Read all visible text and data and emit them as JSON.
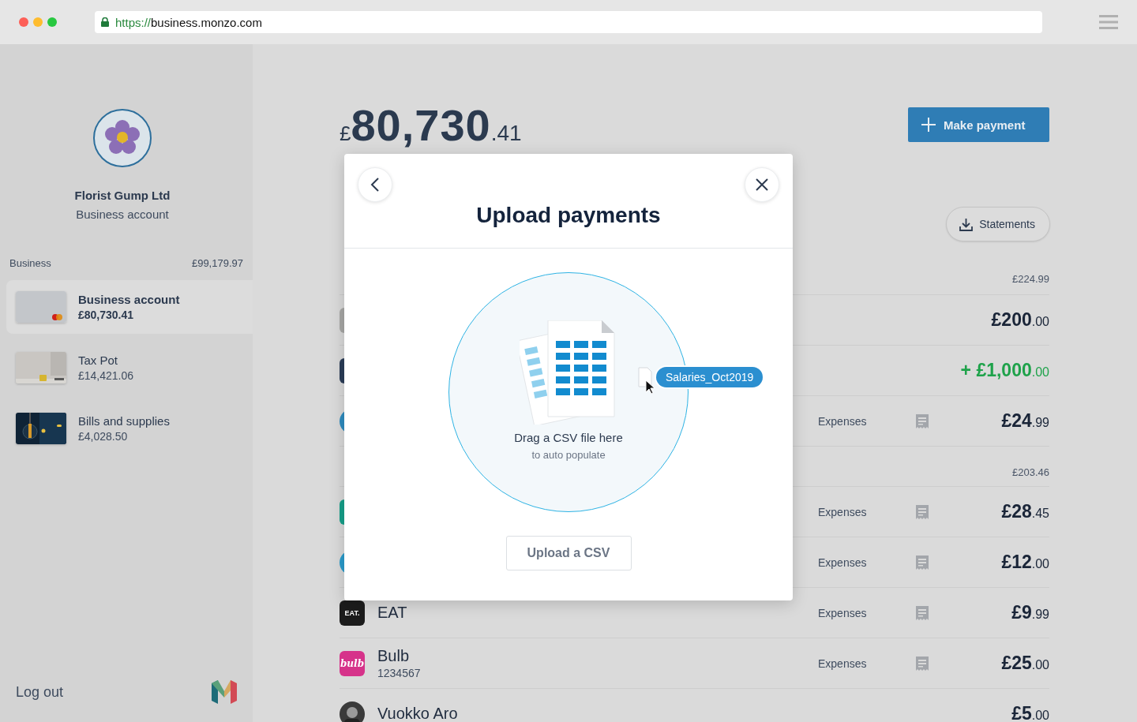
{
  "browser": {
    "url_scheme": "https://",
    "url_host": "business.monzo.com"
  },
  "sidebar": {
    "business_name": "Florist Gump Ltd",
    "account_type": "Business account",
    "group": {
      "label": "Business",
      "total": "£99,179.97"
    },
    "accounts": [
      {
        "name": "Business account",
        "balance": "£80,730.41",
        "selected": true,
        "kind": "card"
      },
      {
        "name": "Tax Pot",
        "balance": "£14,421.06",
        "selected": false,
        "kind": "picture"
      },
      {
        "name": "Bills and supplies",
        "balance": "£4,028.50",
        "selected": false,
        "kind": "picture"
      }
    ],
    "logout": "Log out"
  },
  "balance": {
    "currency": "£",
    "major": "80,730",
    "minor": ".41"
  },
  "make_payment": "Make payment",
  "statements": "Statements",
  "sections": [
    {
      "total": "£224.99",
      "transactions": [
        {
          "avatar": {
            "kind": "square",
            "color": "#a8a8a6"
          },
          "amount_major": "£200",
          "amount_minor": ".00",
          "incoming": false
        },
        {
          "avatar": {
            "kind": "square",
            "color": "#2b3d58"
          },
          "amount_major": "+ £1,000",
          "amount_minor": ".00",
          "incoming": true
        },
        {
          "avatar": {
            "kind": "circle",
            "color": "#2e8cc0"
          },
          "category": "Expenses",
          "receipt": true,
          "amount_major": "£24",
          "amount_minor": ".99",
          "incoming": false
        }
      ]
    },
    {
      "total": "£203.46",
      "transactions": [
        {
          "avatar": {
            "kind": "square",
            "color": "#16a08a"
          },
          "category": "Expenses",
          "receipt": true,
          "amount_major": "£28",
          "amount_minor": ".45",
          "incoming": false
        },
        {
          "avatar": {
            "kind": "circle",
            "color": "#2a9ccc"
          },
          "category": "Expenses",
          "receipt": true,
          "amount_major": "£12",
          "amount_minor": ".00",
          "incoming": false
        },
        {
          "avatar": {
            "kind": "logo",
            "color": "#1c1c1c",
            "text": "EAT."
          },
          "name": "EAT",
          "category": "Expenses",
          "receipt": true,
          "amount_major": "£9",
          "amount_minor": ".99",
          "incoming": false
        },
        {
          "avatar": {
            "kind": "script-logo",
            "color": "#d6338a",
            "text": "bulb"
          },
          "name": "Bulb",
          "reference": "1234567",
          "category": "Expenses",
          "receipt": true,
          "amount_major": "£25",
          "amount_minor": ".00",
          "incoming": false
        },
        {
          "name": "Vuokko Aro",
          "amount_major": "£5",
          "amount_minor": ".00",
          "incoming": false
        }
      ]
    }
  ],
  "modal": {
    "title": "Upload payments",
    "drop_title": "Drag a CSV file here",
    "drop_subtitle": "to auto populate",
    "dragged_file": "Salaries_Oct2019",
    "button": "Upload a CSV"
  }
}
